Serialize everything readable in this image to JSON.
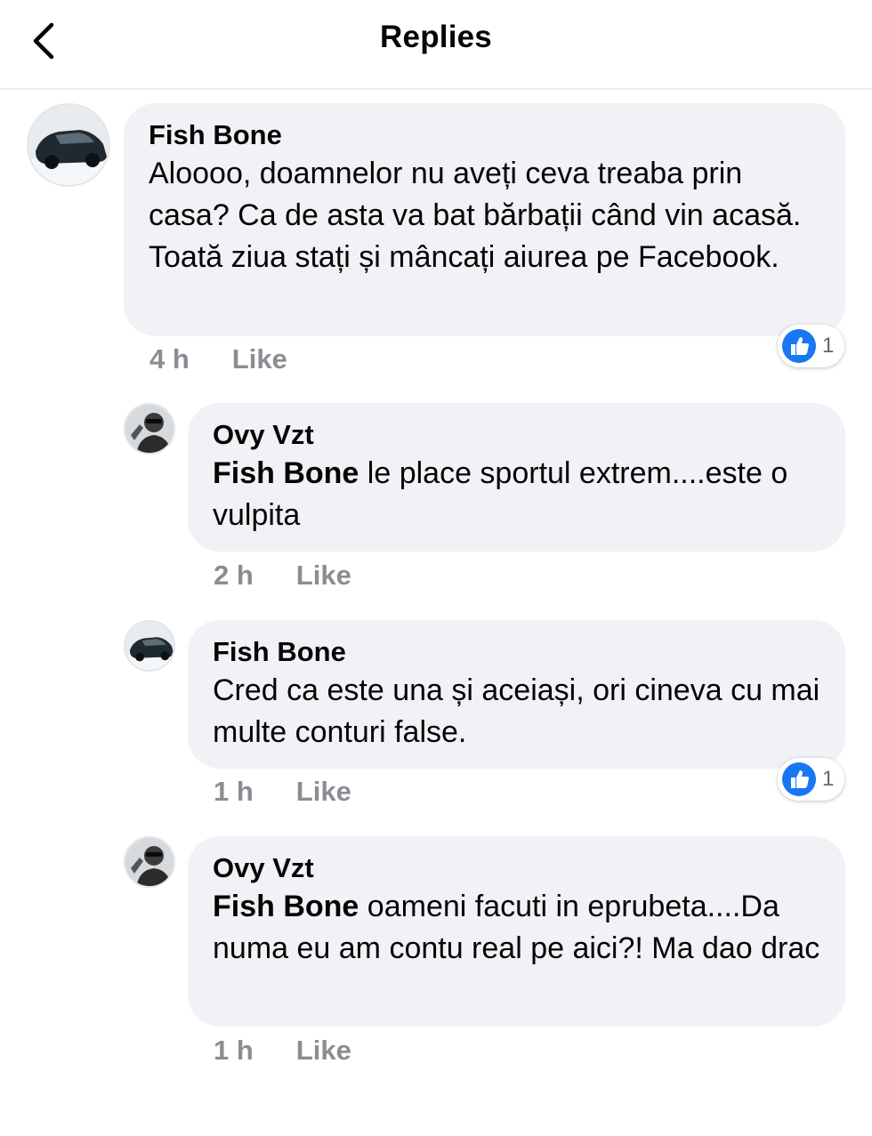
{
  "header": {
    "title": "Replies"
  },
  "comments": [
    {
      "author": "Fish Bone",
      "mention": "",
      "text": "Aloooo, doamnelor nu aveți ceva treaba prin casa? Ca de asta va bat bărbații când vin acasă. Toată ziua stați și mâncați aiurea pe Facebook.",
      "time": "4 h",
      "like": "Like",
      "reactions": "1"
    },
    {
      "author": "Ovy Vzt",
      "mention": "Fish Bone",
      "text": "le place sportul extrem....este o vulpita",
      "time": "2 h",
      "like": "Like"
    },
    {
      "author": "Fish Bone",
      "mention": "",
      "text": "Cred ca este una și aceiași, ori cineva cu mai multe conturi false.",
      "time": "1 h",
      "like": "Like",
      "reactions": "1"
    },
    {
      "author": "Ovy Vzt",
      "mention": "Fish Bone",
      "text": "oameni facuti in eprubeta....Da numa eu am contu real pe aici?! Ma dao drac",
      "time": "1 h",
      "like": "Like"
    }
  ]
}
